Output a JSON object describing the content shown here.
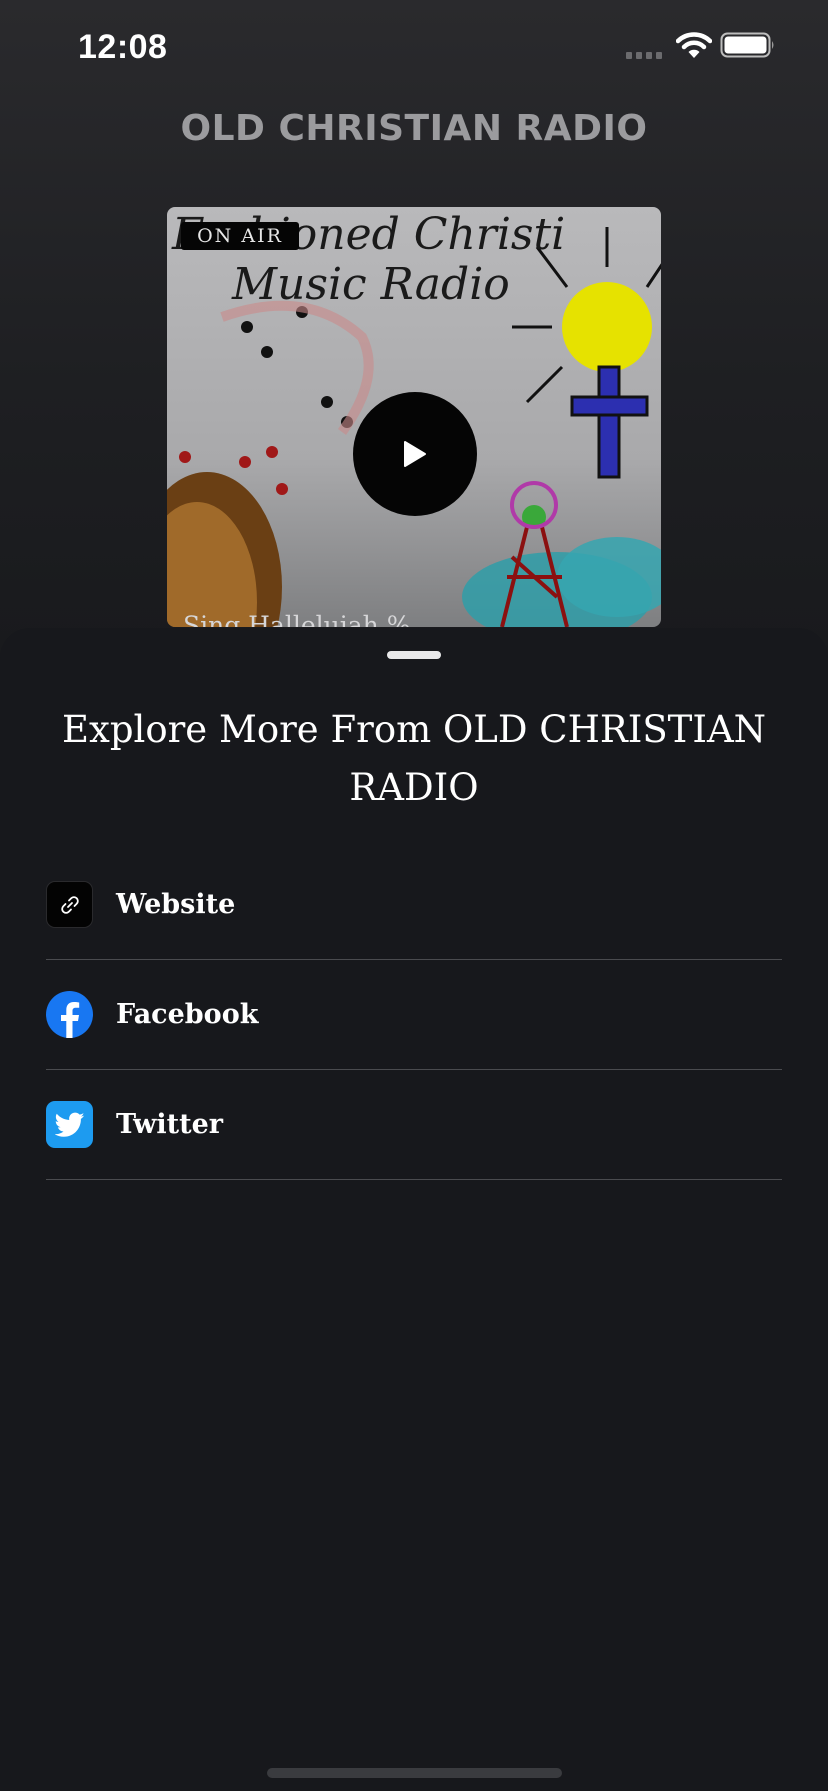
{
  "status_bar": {
    "time": "12:08",
    "icons": [
      "cellular-signal-icon",
      "wifi-icon",
      "battery-icon"
    ]
  },
  "header": {
    "station_title": "OLD CHRISTIAN RADIO"
  },
  "player": {
    "on_air_label": "ON AIR",
    "now_playing": "Sing Halleluiah %",
    "play_icon": "play-icon",
    "artwork_text": [
      "Fashioned Christi",
      "Music Radio"
    ]
  },
  "sheet": {
    "title": "Explore More From OLD CHRISTIAN RADIO",
    "links": [
      {
        "label": "Website",
        "icon": "link-icon",
        "color": "#030303"
      },
      {
        "label": "Facebook",
        "icon": "facebook-icon",
        "color": "#1877f2"
      },
      {
        "label": "Twitter",
        "icon": "twitter-icon",
        "color": "#1d9bf0"
      }
    ]
  },
  "colors": {
    "background": "#17181c",
    "text": "#ffffff",
    "muted_title": "#9b9b9e",
    "divider": "#4a4b4f"
  }
}
